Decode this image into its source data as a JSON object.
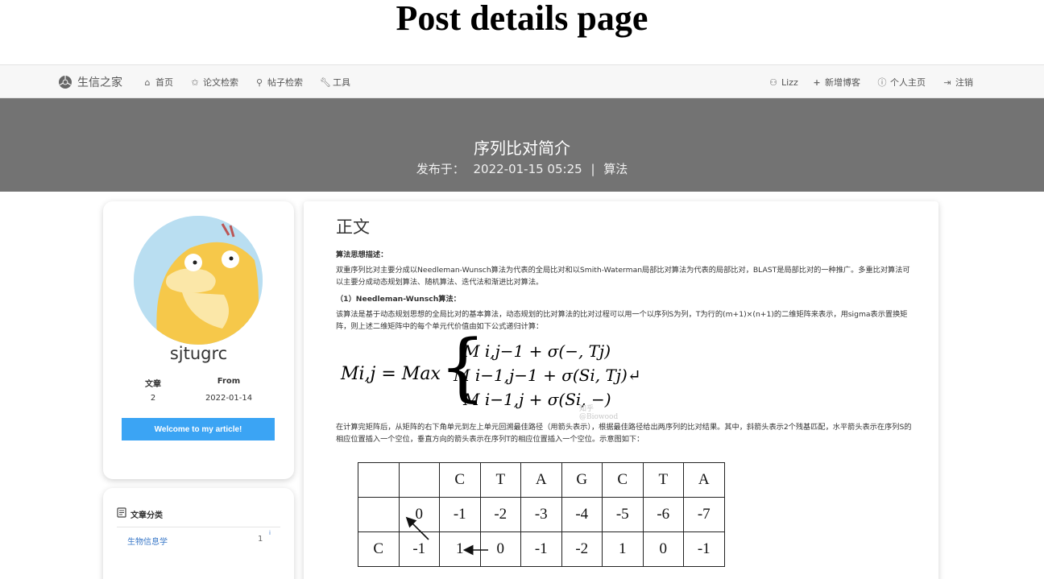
{
  "caption": "Post details page",
  "nav": {
    "brand": "生信之家",
    "items": [
      {
        "label": "首页",
        "icon": "home-icon"
      },
      {
        "label": "论文检索",
        "icon": "star-icon"
      },
      {
        "label": "帖子检索",
        "icon": "search-icon"
      },
      {
        "label": "工具",
        "icon": "wrench-icon"
      }
    ],
    "right_items": [
      {
        "label": "Lizz",
        "icon": "user-icon"
      },
      {
        "label": "新增博客",
        "icon": "plus-icon"
      },
      {
        "label": "个人主页",
        "icon": "info-icon"
      },
      {
        "label": "注销",
        "icon": "logout-icon"
      }
    ]
  },
  "post": {
    "title": "序列比对简介",
    "published_label": "发布于：",
    "datetime": "2022-01-15 05:25",
    "separator": "|",
    "category": "算法"
  },
  "profile": {
    "username": "sjtugrc",
    "stats_headers": [
      "文章",
      "From"
    ],
    "stats_values": [
      "2",
      "2022-01-14"
    ],
    "welcome_button": "Welcome to my article!"
  },
  "categories": {
    "heading": "文章分类",
    "items": [
      {
        "name": "生物信息学",
        "count": "1",
        "sup": "i"
      }
    ]
  },
  "content": {
    "heading": "正文",
    "section1_title": "算法思想描述：",
    "para1": "双重序列比对主要分成以Needleman-Wunsch算法为代表的全局比对和以Smith-Waterman局部比对算法为代表的局部比对，BLAST是局部比对的一种推广。多重比对算法可以主要分成动态规划算法、随机算法、迭代法和渐进比对算法。",
    "section2_title": "（1）Needleman-Wunsch算法：",
    "para2": "该算法是基于动态规划思想的全局比对的基本算法，动态规划的比对算法的比对过程可以用一个以序列S为列，T为行的(m+1)×(n+1)的二维矩阵来表示，用sigma表示置换矩阵，则上述二维矩阵中的每个单元代价值由如下公式递归计算：",
    "formula": {
      "lhs": "Mi,j = Max",
      "rows": [
        "M i,j−1 + σ(−, Tj)",
        "M i−1,j−1 + σ(Si, Tj)↵",
        "M i−1,j + σ(Si, −)"
      ],
      "watermark": "知乎 @Biowood"
    },
    "para3": "在计算完矩阵后，从矩阵的右下角单元到左上单元回溯最佳路径（用箭头表示），根据最佳路径给出两序列的比对结果。其中，斜箭头表示2个残基匹配，水平箭头表示在序列S的相应位置插入一个空位，垂直方向的箭头表示在序列T的相应位置插入一个空位。示意图如下：",
    "table": [
      [
        "",
        "",
        "C",
        "T",
        "A",
        "G",
        "C",
        "T",
        "A"
      ],
      [
        "",
        "0",
        "-1",
        "-2",
        "-3",
        "-4",
        "-5",
        "-6",
        "-7"
      ],
      [
        "C",
        "-1",
        "1",
        "0",
        "-1",
        "-2",
        "1",
        "0",
        "-1"
      ]
    ]
  }
}
